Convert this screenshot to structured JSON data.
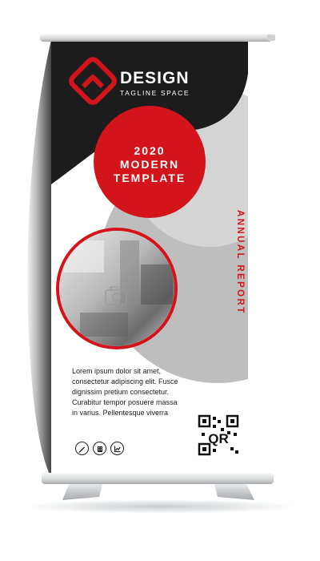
{
  "brand": {
    "name": "DESIGN",
    "tagline": "TAGLINE SPACE"
  },
  "headline": {
    "lines": [
      "2020",
      "MODERN",
      "TEMPLATE"
    ]
  },
  "vertical_text": "ANNUAL REPORT",
  "body_text": {
    "lines": [
      "Lorem ipsum dolor sit amet,",
      "consectetur adipiscing elit. Fusce",
      "dignissim pretium consectetur.",
      "Curabitur tempor posuere massa",
      "in varius. Pellentesque viverra"
    ]
  },
  "icons": [
    "pen-icon",
    "building-icon",
    "chart-icon"
  ],
  "image_placeholder_icon": "camera-icon",
  "qr_label": "QR",
  "colors": {
    "accent": "#d3141b",
    "dark": "#1c1c1c",
    "gray": "#bdbdbd",
    "light_gray": "#d6d6d6",
    "paper": "#ffffff"
  }
}
